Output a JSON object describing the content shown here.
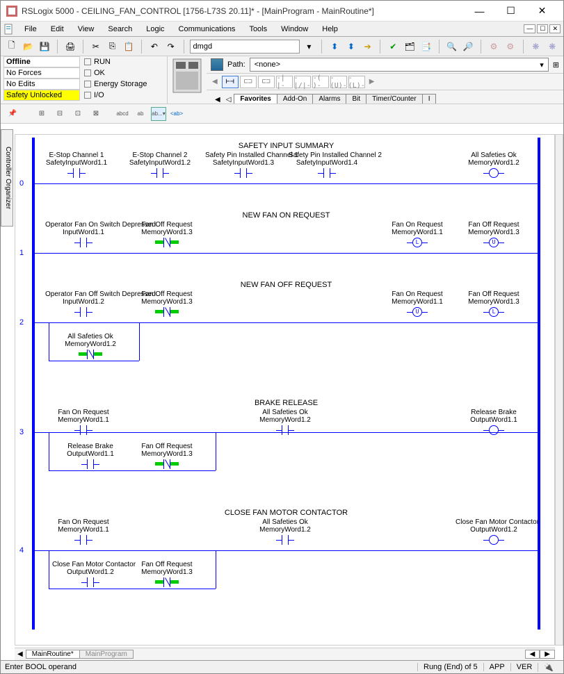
{
  "window": {
    "title": "RSLogix 5000 - CEILING_FAN_CONTROL [1756-L73S 20.11]* - [MainProgram - MainRoutine*]"
  },
  "menu": {
    "file": "File",
    "edit": "Edit",
    "view": "View",
    "search": "Search",
    "logic": "Logic",
    "comm": "Communications",
    "tools": "Tools",
    "window": "Window",
    "help": "Help"
  },
  "quick_access": {
    "value": "dmgd"
  },
  "status": {
    "offline": "Offline",
    "no_forces": "No Forces",
    "no_edits": "No Edits",
    "safety": "Safety Unlocked",
    "run": "RUN",
    "ok": "OK",
    "energy": "Energy Storage",
    "io": "I/O"
  },
  "path": {
    "label": "Path:",
    "value": "<none>"
  },
  "elem_tabs": {
    "fav": "Favorites",
    "addon": "Add-On",
    "alarms": "Alarms",
    "bit": "Bit",
    "timer": "Timer/Counter",
    "i": "I"
  },
  "side_tab": "Controller Organizer",
  "rungs": [
    {
      "num": "0",
      "title": "SAFETY INPUT SUMMARY",
      "row1": [
        {
          "lbl": "E-Stop Channel 1",
          "addr": "SafetyInputWord1.1",
          "type": "xic"
        },
        {
          "lbl": "E-Stop Channel 2",
          "addr": "SafetyInputWord1.2",
          "type": "xic"
        },
        {
          "lbl": "Safety Pin Installed Channel 1",
          "addr": "SafetyInputWord1.3",
          "type": "xic"
        },
        {
          "lbl": "Safety Pin Installed Channel 2",
          "addr": "SafetyInputWord1.4",
          "type": "xic"
        }
      ],
      "out": [
        {
          "lbl": "All Safeties Ok",
          "addr": "MemoryWord1.2",
          "type": "ote"
        }
      ]
    },
    {
      "num": "1",
      "title": "NEW FAN ON REQUEST",
      "row1": [
        {
          "lbl": "Operator Fan On Switch Depressed",
          "addr": "InputWord1.1",
          "type": "xic"
        },
        {
          "lbl": "Fan Off Request",
          "addr": "MemoryWord1.3",
          "type": "xio",
          "hl": true
        }
      ],
      "out": [
        {
          "lbl": "Fan On Request",
          "addr": "MemoryWord1.1",
          "type": "otl"
        },
        {
          "lbl": "Fan Off Request",
          "addr": "MemoryWord1.3",
          "type": "otu"
        }
      ]
    },
    {
      "num": "2",
      "title": "NEW FAN OFF REQUEST",
      "row1": [
        {
          "lbl": "Operator Fan Off Switch Depressed",
          "addr": "InputWord1.2",
          "type": "xic"
        },
        {
          "lbl": "Fan Off Request",
          "addr": "MemoryWord1.3",
          "type": "xio",
          "hl": true
        }
      ],
      "branch": [
        {
          "lbl": "All Safeties Ok",
          "addr": "MemoryWord1.2",
          "type": "xio",
          "hl": true
        }
      ],
      "out": [
        {
          "lbl": "Fan On Request",
          "addr": "MemoryWord1.1",
          "type": "otu"
        },
        {
          "lbl": "Fan Off Request",
          "addr": "MemoryWord1.3",
          "type": "otl"
        }
      ]
    },
    {
      "num": "3",
      "title": "BRAKE RELEASE",
      "row1": [
        {
          "lbl": "Fan On Request",
          "addr": "MemoryWord1.1",
          "type": "xic"
        },
        {
          "lbl": "All Safeties Ok",
          "addr": "MemoryWord1.2",
          "type": "xic",
          "pos": "mid"
        }
      ],
      "branch": [
        {
          "lbl": "Release Brake",
          "addr": "OutputWord1.1",
          "type": "xic"
        },
        {
          "lbl": "Fan Off Request",
          "addr": "MemoryWord1.3",
          "type": "xio",
          "hl": true
        }
      ],
      "out": [
        {
          "lbl": "Release Brake",
          "addr": "OutputWord1.1",
          "type": "ote"
        }
      ]
    },
    {
      "num": "4",
      "title": "CLOSE FAN MOTOR CONTACTOR",
      "row1": [
        {
          "lbl": "Fan On Request",
          "addr": "MemoryWord1.1",
          "type": "xic"
        },
        {
          "lbl": "All Safeties Ok",
          "addr": "MemoryWord1.2",
          "type": "xic",
          "pos": "mid"
        }
      ],
      "branch": [
        {
          "lbl": "Close Fan Motor Contactor",
          "addr": "OutputWord1.2",
          "type": "xic"
        },
        {
          "lbl": "Fan Off Request",
          "addr": "MemoryWord1.3",
          "type": "xio",
          "hl": true
        }
      ],
      "out": [
        {
          "lbl": "Close Fan Motor Contactor",
          "addr": "OutputWord1.2",
          "type": "ote"
        }
      ]
    }
  ],
  "bottom_tabs": {
    "main": "MainRoutine*",
    "prog": "MainProgram"
  },
  "statusbar": {
    "msg": "Enter BOOL operand",
    "pos": "Rung (End) of 5",
    "app": "APP",
    "ver": "VER"
  },
  "coil_letters": {
    "otl": "L",
    "otu": "U"
  }
}
